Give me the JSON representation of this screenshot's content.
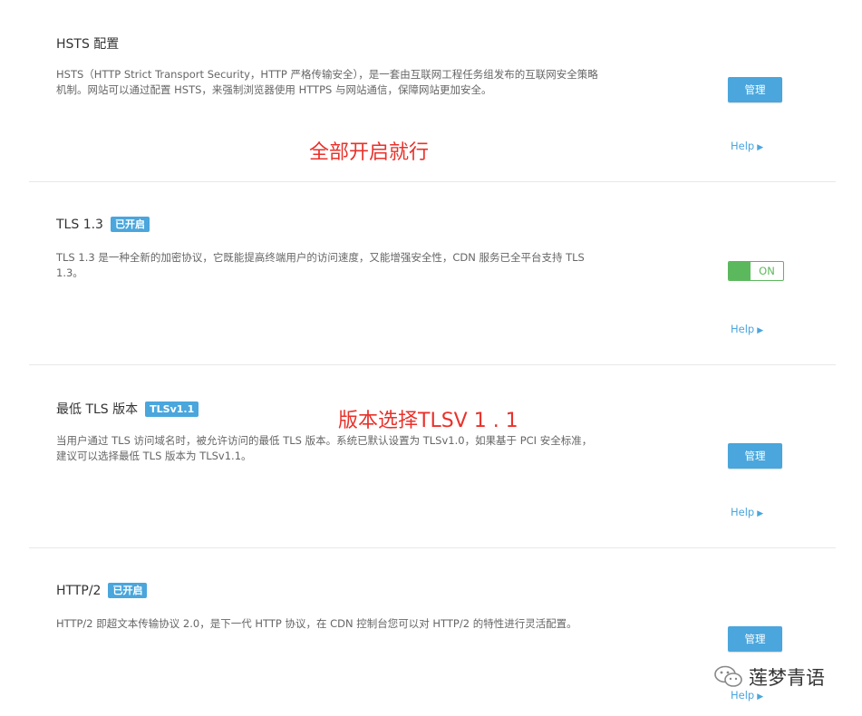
{
  "sections": [
    {
      "title": "HSTS 配置",
      "badge": "",
      "description": "HSTS（HTTP Strict Transport Security，HTTP 严格传输安全），是一套由互联网工程任务组发布的互联网安全策略机制。网站可以通过配置 HSTS，来强制浏览器使用 HTTPS 与网站通信，保障网站更加安全。",
      "action_label": "管理",
      "help_label": "Help",
      "annotation": "全部开启就行"
    },
    {
      "title": "TLS 1.3",
      "badge": "已开启",
      "description": "TLS 1.3 是一种全新的加密协议，它既能提高终端用户的访问速度，又能增强安全性，CDN 服务已全平台支持 TLS 1.3。",
      "toggle_label": "ON",
      "toggle_on": true,
      "help_label": "Help"
    },
    {
      "title": "最低 TLS 版本",
      "badge": "TLSv1.1",
      "description": "当用户通过 TLS 访问域名时，被允许访问的最低 TLS 版本。系统已默认设置为 TLSv1.0，如果基于 PCI 安全标准，建议可以选择最低 TLS 版本为 TLSv1.1。",
      "action_label": "管理",
      "help_label": "Help",
      "annotation": "版本选择TLSV 1 . 1"
    },
    {
      "title": "HTTP/2",
      "badge": "已开启",
      "description": "HTTP/2 即超文本传输协议 2.0，是下一代 HTTP 协议，在 CDN 控制台您可以对 HTTP/2 的特性进行灵活配置。",
      "action_label": "管理",
      "help_label": "Help"
    }
  ],
  "help_arrow": "▶",
  "watermark": {
    "text": "莲梦青语",
    "icon": "wechat-icon"
  },
  "colors": {
    "accent": "#4aa6dc",
    "toggle_on": "#5cb85c",
    "annotation": "#e8322b"
  }
}
